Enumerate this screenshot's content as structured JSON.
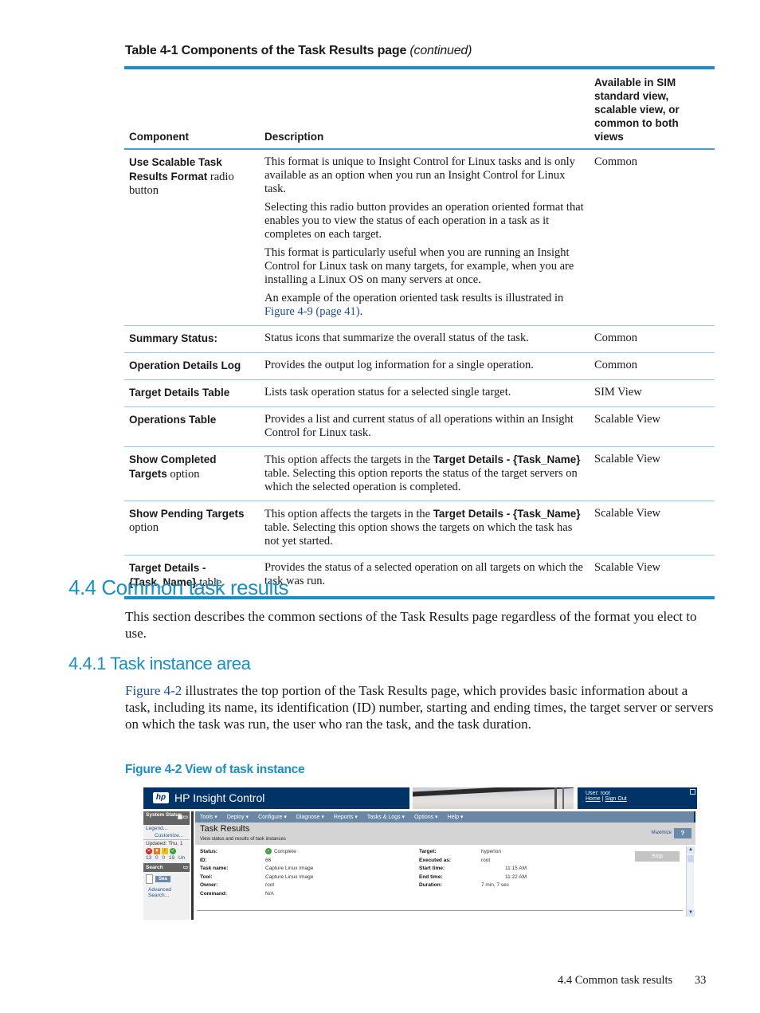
{
  "table": {
    "caption": "Table 4-1 Components of the Task Results page",
    "caption_suffix": "(continued)",
    "headers": [
      "Component",
      "Description",
      "Available in SIM standard view, scalable view, or common to both views"
    ],
    "rows": [
      {
        "component_bold": "Use Scalable Task Results Format",
        "component_rest": " radio button",
        "description": [
          "This format is unique to Insight Control for Linux tasks and is only available as an option when you run an Insight Control for Linux task.",
          "Selecting this radio button provides an operation oriented format that enables you to view the status of each operation in a task as it completes on each target.",
          "This format is particularly useful when you are running an Insight Control for Linux task on many targets, for example, when you are installing a Linux OS on many servers at once."
        ],
        "description_last_prefix": "An example of the operation oriented task results is illustrated in ",
        "description_last_link": "Figure 4-9 (page 41)",
        "description_last_suffix": ".",
        "availability": "Common"
      },
      {
        "component_bold": "Summary Status:",
        "component_rest": "",
        "description": "Status icons that summarize the overall status of the task.",
        "availability": "Common"
      },
      {
        "component_bold": "Operation Details Log",
        "component_rest": "",
        "description": "Provides the output log information for a single operation.",
        "availability": "Common"
      },
      {
        "component_bold": "Target Details Table",
        "component_rest": "",
        "description": "Lists task operation status for a selected single target.",
        "availability": "SIM View"
      },
      {
        "component_bold": "Operations Table",
        "component_rest": "",
        "description": "Provides a list and current status of all operations within an Insight Control for Linux task.",
        "availability": "Scalable View"
      },
      {
        "component_bold": "Show Completed Targets",
        "component_rest": " option",
        "desc_prefix": "This option affects the targets in the ",
        "desc_bold": "Target Details - {Task_Name}",
        "desc_suffix": " table. Selecting this option reports the status of the target servers on which the selected operation is completed.",
        "availability": "Scalable View"
      },
      {
        "component_bold": "Show Pending Targets",
        "component_rest": " option",
        "desc_prefix": "This option affects the targets in the ",
        "desc_bold": "Target Details - {Task_Name}",
        "desc_suffix": " table. Selecting this option shows the targets on which the task has not yet started.",
        "availability": "Scalable View"
      },
      {
        "component_bold": "Target Details - {Task_Name}",
        "component_rest": " table",
        "description": "Provides the status of a selected operation on all targets on which the task was run.",
        "availability": "Scalable View"
      }
    ]
  },
  "section": {
    "heading": "4.4 Common task results",
    "intro": "This section describes the common sections of the Task Results page regardless of the format you elect to use.",
    "subheading": "4.4.1 Task instance area",
    "para_link": "Figure 4-2",
    "para_text": " illustrates the top portion of the Task Results page, which provides basic information about a task, including its name, its identification (ID) number, starting and ending times, the target server or servers on which the task was run, the user who ran the task, and the task duration.",
    "figure_caption": "Figure 4-2 View of task instance"
  },
  "figure": {
    "brand_logo": "hp",
    "brand_title": "HP Insight Control",
    "user_label": "User: root",
    "home_link": "Home",
    "separator": "|",
    "signout_link": "Sign Out",
    "left_nav": {
      "system_status_title": "System Status",
      "legend_link": "Legend...",
      "customize_link": "Customize...",
      "updated_text": "Updated: Thu, 1",
      "status_counts": [
        "13",
        "0",
        "0",
        "19 Un"
      ],
      "search_title": "Search",
      "search_button": "Sea",
      "advanced_search": "Advanced Search...",
      "search_link_trunc": "Sea"
    },
    "menu": [
      "Tools ▾",
      "Deploy ▾",
      "Configure ▾",
      "Diagnose ▾",
      "Reports ▾",
      "Tasks & Logs ▾",
      "Options ▾",
      "Help ▾"
    ],
    "page_title": "Task Results",
    "page_subtitle": "View status and results of task instances",
    "maximize": "Maximize",
    "help": "?",
    "stop": "Stop",
    "left_fields": [
      {
        "k": "Status:",
        "v": "Complete"
      },
      {
        "k": "ID:",
        "v": "66"
      },
      {
        "k": "Task name:",
        "v": "Capture Linux Image"
      },
      {
        "k": "Tool:",
        "v": "Capture Linux Image"
      },
      {
        "k": "Owner:",
        "v": "root"
      },
      {
        "k": "Command:",
        "v": "N/A"
      }
    ],
    "right_fields": [
      {
        "k": "Target:",
        "v": "hyperion"
      },
      {
        "k": "Executed as:",
        "v": "root"
      },
      {
        "k": "Start time:",
        "v": "11:15 AM"
      },
      {
        "k": "End time:",
        "v": "11:22 AM"
      },
      {
        "k": "Duration:",
        "v": "7 min, 7 sec"
      }
    ]
  },
  "footer": {
    "section": "4.4 Common task results",
    "page": "33"
  }
}
